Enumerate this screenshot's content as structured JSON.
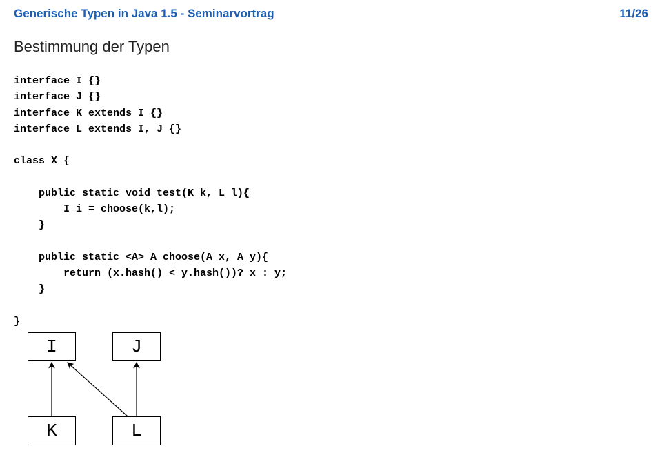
{
  "header": {
    "title": "Generische Typen in Java 1.5 - Seminarvortrag",
    "page": "11/26"
  },
  "subtitle": "Bestimmung der Typen",
  "code": {
    "line1": "interface I {}",
    "line2": "interface J {}",
    "line3": "interface K extends I {}",
    "line4": "interface L extends I, J {}",
    "line5": "class X {",
    "line6": "    public static void test(K k, L l){",
    "line7": "        I i = choose(k,l);",
    "line8": "    }",
    "line9": "    public static <A> A choose(A x, A y){",
    "line10": "        return (x.hash() < y.hash())? x : y;",
    "line11": "    }",
    "line12": "}"
  },
  "diagram": {
    "boxI": "I",
    "boxJ": "J",
    "boxK": "K",
    "boxL": "L"
  }
}
